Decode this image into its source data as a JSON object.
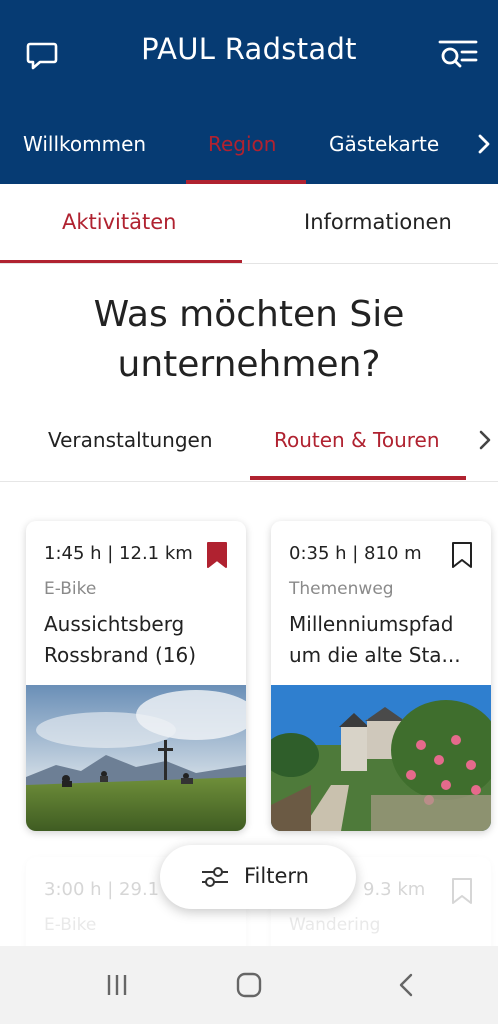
{
  "app": {
    "title": "PAUL Radstadt"
  },
  "colors": {
    "brand_blue": "#063b73",
    "accent_red": "#b02230"
  },
  "icons": {
    "left": "chat-bubble-icon",
    "right": "search-list-icon"
  },
  "nav": {
    "tabs": [
      {
        "label": "Willkommen"
      },
      {
        "label": "Region"
      },
      {
        "label": "Gästekarte"
      }
    ]
  },
  "subtabs": {
    "items": [
      {
        "label": "Aktivitäten"
      },
      {
        "label": "Informationen"
      }
    ]
  },
  "main": {
    "heading_line1": "Was möchten Sie",
    "heading_line2": "unternehmen?",
    "categories": [
      {
        "label": "Veranstaltungen"
      },
      {
        "label": "Routen & Touren"
      }
    ]
  },
  "cards": [
    {
      "meta": "1:45 h | 12.1 km",
      "category": "E-Bike",
      "name_line1": "Aussichtsberg",
      "name_line2": "Rossbrand (16)",
      "bookmarked": true,
      "image": "mountain-summit-cross-photo"
    },
    {
      "meta": "0:35 h | 810 m",
      "category": "Themenweg",
      "name_line1": "Millenniumspfad",
      "name_line2": "um die alte Sta...",
      "bookmarked": false,
      "image": "town-path-roses-photo"
    },
    {
      "meta": "3:00 h | 29.1",
      "category": "E-Bike"
    },
    {
      "meta": "9.3 km",
      "category": "Wandering"
    }
  ],
  "filter": {
    "label": "Filtern"
  }
}
